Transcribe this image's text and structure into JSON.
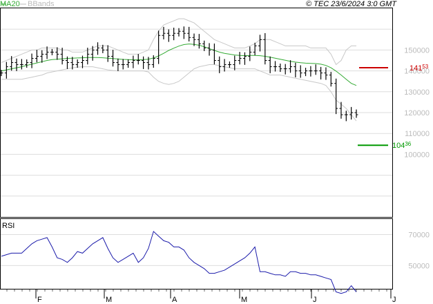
{
  "header": {
    "legend_ma": "MA20",
    "legend_bb": "BBands",
    "copyright": "© TEC 23/6/2024 3:0 GMT"
  },
  "price_panel": {
    "y_tick_labels": [
      "150000",
      "140000",
      "130000",
      "120000",
      "110000",
      "100000"
    ],
    "target_high": {
      "value": "141",
      "sup": "53",
      "color": "#cc0000"
    },
    "target_low": {
      "value": "104",
      "sup": "36",
      "color": "#009900"
    }
  },
  "rsi_panel": {
    "label": "RSI",
    "y_tick_labels": [
      "70000",
      "50000"
    ]
  },
  "x_axis": {
    "month_labels": [
      "F",
      "M",
      "A",
      "M",
      "J",
      "J"
    ]
  },
  "colors": {
    "ma_line": "#33aa33",
    "bbands": "#cccccc",
    "rsi_line": "#1a1aaa",
    "bars": "#000000",
    "grid": "#d8d8d8"
  },
  "chart_data": [
    {
      "type": "ohlc",
      "title": "",
      "ylim": [
        70,
        170
      ],
      "yticks": [
        150,
        140,
        130,
        120,
        110,
        100
      ],
      "x_months": [
        "F",
        "M",
        "A",
        "M",
        "J",
        "J"
      ],
      "close": [
        139,
        142,
        144,
        143,
        143,
        144,
        146,
        147,
        148,
        149,
        149,
        148,
        145,
        144,
        143,
        144,
        145,
        148,
        150,
        151,
        150,
        147,
        144,
        143,
        143,
        144,
        145,
        145,
        144,
        143,
        146,
        157,
        158,
        157,
        158,
        159,
        158,
        156,
        155,
        153,
        151,
        150,
        145,
        142,
        143,
        143,
        145,
        146,
        147,
        149,
        152,
        155,
        145,
        142,
        142,
        141,
        141,
        142,
        140,
        139,
        140,
        140,
        140,
        139,
        138,
        134,
        122,
        119,
        119,
        120,
        119
      ],
      "ma20": [
        140,
        140.5,
        141,
        141.5,
        142,
        142.6,
        143.2,
        143.8,
        144.4,
        145,
        145.4,
        145.6,
        145.8,
        146,
        146.1,
        146.2,
        146.3,
        146.4,
        146.4,
        146.4,
        146.3,
        146.1,
        145.9,
        145.7,
        145.5,
        145.4,
        145.3,
        145.3,
        145.4,
        145.6,
        146.2,
        147.2,
        148.4,
        149.8,
        150.9,
        151.9,
        152.6,
        152.9,
        152.7,
        152.3,
        151.6,
        150.7,
        149.8,
        149,
        148.4,
        148,
        147.6,
        147.4,
        147.3,
        147.4,
        147.4,
        147.3,
        147,
        146.6,
        146.1,
        145.6,
        145.1,
        144.6,
        144.2,
        143.9,
        143.7,
        143.6,
        143.5,
        143.2,
        142.6,
        141.5,
        139.9,
        138,
        136,
        134,
        133
      ],
      "bb_upper": [
        144,
        145,
        146,
        147,
        148,
        149,
        150,
        150,
        151,
        151,
        151,
        151,
        150,
        150,
        149,
        149,
        149,
        150,
        151,
        152,
        152,
        152,
        151,
        150,
        149,
        148,
        148,
        148,
        149,
        150,
        155,
        159,
        162,
        163,
        164,
        165,
        165,
        164,
        163,
        161,
        159,
        157,
        155,
        154,
        153,
        152,
        151,
        151,
        151,
        152,
        153,
        155,
        155,
        155,
        154,
        153,
        152,
        152,
        152,
        152,
        152,
        151,
        151,
        151,
        151,
        148,
        143,
        145,
        150,
        152,
        152
      ],
      "bb_lower": [
        136,
        136,
        136,
        136,
        136,
        136.5,
        137,
        137.5,
        138,
        139,
        139.5,
        140,
        140.5,
        141,
        141.5,
        141.8,
        142,
        142,
        142,
        141.5,
        141,
        140.5,
        140.2,
        140,
        140,
        140,
        140,
        140,
        140,
        139.5,
        137,
        135,
        134,
        133.5,
        134,
        135,
        137,
        139,
        141,
        142,
        142.5,
        143,
        143,
        142.5,
        142,
        141.5,
        141,
        141,
        141,
        141,
        141,
        140,
        139,
        138,
        138,
        138,
        137.5,
        137,
        136.5,
        136,
        135.5,
        135,
        134.5,
        134,
        133,
        130,
        126,
        124,
        122,
        119,
        116
      ],
      "targets": [
        141.53,
        104.36
      ]
    },
    {
      "type": "line",
      "title": "RSI",
      "ylim": [
        35,
        80
      ],
      "yticks": [
        70,
        50
      ],
      "values": [
        56,
        57,
        58,
        58,
        58,
        61,
        64,
        66,
        67,
        68,
        62,
        55,
        54,
        52,
        55,
        59,
        58,
        61,
        64,
        66,
        68,
        61,
        55,
        52,
        54,
        56,
        58,
        52,
        55,
        61,
        72,
        69,
        66,
        65,
        62,
        62,
        60,
        55,
        52,
        50,
        48,
        45,
        45,
        46,
        47,
        49,
        51,
        53,
        55,
        58,
        62,
        46,
        46,
        45,
        44,
        44,
        43,
        46,
        46,
        45,
        45,
        44,
        44,
        43,
        42,
        41,
        33,
        32,
        33,
        37,
        33
      ]
    }
  ]
}
